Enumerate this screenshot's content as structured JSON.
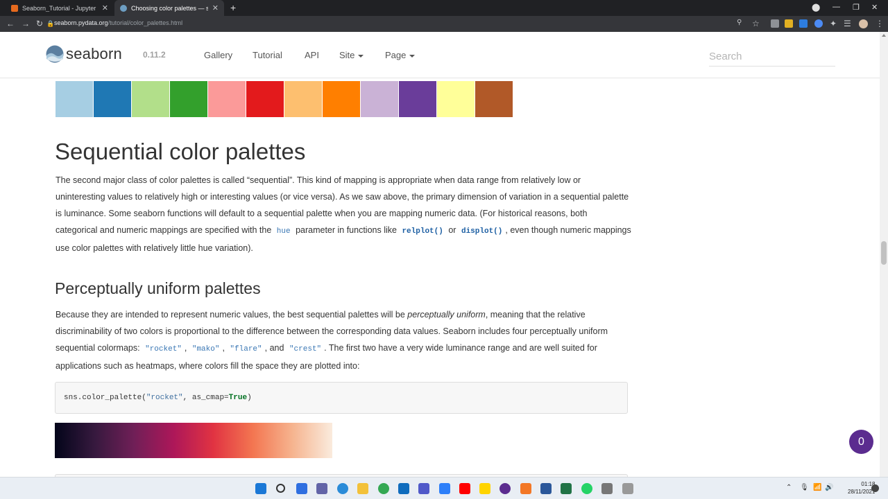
{
  "browser": {
    "tabs": [
      {
        "title": "Seaborn_Tutorial - Jupyter Notebook",
        "active": false
      },
      {
        "title": "Choosing color palettes — seaborn",
        "active": true
      }
    ],
    "url_host": "seaborn.pydata.org",
    "url_path": "/tutorial/color_palettes.html"
  },
  "site": {
    "logo_text": "seaborn",
    "version": "0.11.2",
    "nav": [
      "Gallery",
      "Tutorial",
      "API",
      "Site",
      "Page"
    ],
    "search_placeholder": "Search"
  },
  "swatch_colors": [
    "#a6cee3",
    "#1f78b4",
    "#b2df8a",
    "#33a02c",
    "#fb9a99",
    "#e31a1c",
    "#fdbf6f",
    "#ff7f00",
    "#cab2d6",
    "#6a3d9a",
    "#ffff99",
    "#b15928"
  ],
  "content": {
    "h_sequential": "Sequential color palettes",
    "p1": {
      "a": "The second major class of color palettes is called “sequential”. This kind of mapping is appropriate when data range from relatively low or uninteresting values to relatively high or interesting values (or vice versa). As we saw above, the primary dimension of variation in a sequential palette is luminance. Some seaborn functions will default to a sequential palette when you are mapping numeric data. (For historical reasons, both categorical and numeric mappings are specified with the",
      "code_hue": "hue",
      "b": "parameter in functions like",
      "code_relplot": "relplot()",
      "c": "or",
      "code_displot": "displot()",
      "d": ", even though numeric mappings use color palettes with relatively little hue variation)."
    },
    "h_perceptual": "Perceptually uniform palettes",
    "p2": {
      "a": "Because they are intended to represent numeric values, the best sequential palettes will be",
      "em": "perceptually uniform",
      "b": ", meaning that the relative discriminability of two colors is proportional to the difference between the corresponding data values. Seaborn includes four perceptually uniform sequential colormaps:",
      "c1": "\"rocket\"",
      "c2": "\"mako\"",
      "c3": "\"flare\"",
      "and": ", and",
      "c4": "\"crest\"",
      "d": ". The first two have a very wide luminance range and are well suited for applications such as heatmaps, where colors fill the space they are plotted into:"
    },
    "code": {
      "pre": "sns.color_palette(",
      "str": "\"rocket\"",
      "mid": ", as_cmap=",
      "kw": "True",
      "post": ")"
    }
  },
  "badge_count": "0",
  "taskbar": {
    "time": "01:18",
    "date": "28/11/2021"
  }
}
